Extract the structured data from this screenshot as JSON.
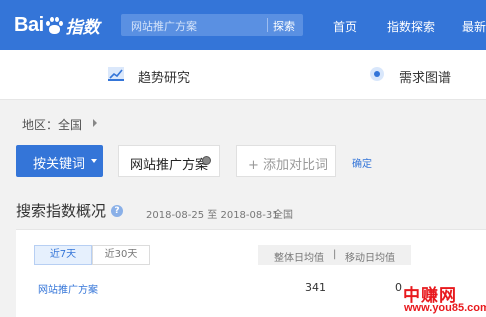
{
  "header": {
    "logo_text_latin": "Bai",
    "logo_text_cn": "指数",
    "logo_mark": "du",
    "search_placeholder": "网站推广方案",
    "search_button": "探索",
    "nav": [
      "首页",
      "指数探索",
      "最新"
    ]
  },
  "subnav": {
    "trend_label": "趋势研究",
    "demand_label": "需求图谱"
  },
  "filters": {
    "region_label": "地区：全国",
    "keyword_button": "按关键词",
    "keyword_value": "网站推广方案",
    "add_compare": "+ 添加对比词",
    "confirm": "确定"
  },
  "overview": {
    "title": "搜索指数概况",
    "date_range": "2018-08-25 至 2018-08-31",
    "region": "全国",
    "tabs": [
      "近7天",
      "近30天"
    ],
    "columns": [
      "整体日均值",
      "|",
      "移动日均值"
    ],
    "rows": [
      {
        "keyword": "网站推广方案",
        "overall": "341",
        "mobile": "0"
      }
    ]
  },
  "watermark": {
    "main": "中赚网",
    "url": "www.you85.com"
  },
  "colors": {
    "brand": "#3475d8",
    "watermark": "#e8191d"
  }
}
